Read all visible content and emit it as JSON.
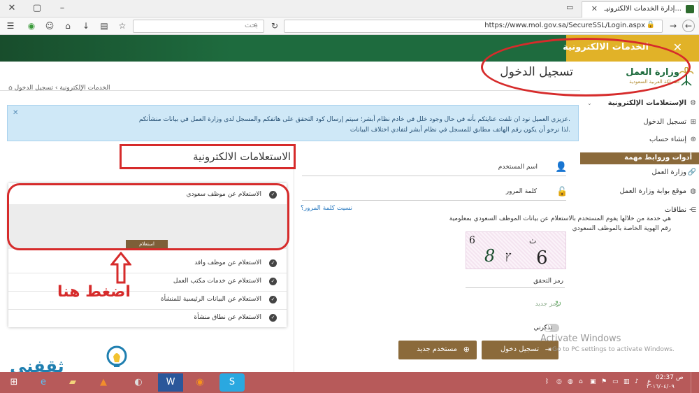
{
  "browser": {
    "tab_title": "إدارة الخدمات الالكترونيـ...",
    "url": "https://www.mol.gov.sa/SecureSSL/Login.aspx",
    "search_placeholder": "بحث"
  },
  "header": {
    "section_title": "الخدمات الالكترونية",
    "page_title": "تسجيل الدخول",
    "logo_name": "وزارة العمل",
    "logo_sub": "المملكة العربية السعودية",
    "breadcrumb": "الخدمات الإلكترونية  ›  تسجيل الدخول"
  },
  "banner": {
    "line1": "عزيزي العميل نود ان نلفت عنايتكم بأنه في حال وجود خلل في خادم نظام أبشر؛ سيتم إرسال كود التحقق على هاتفكم والمسجل لدى وزارة العمل في بيانات منشأتكم.",
    "line2": "لذا نرجو أن يكون رقم الهاتف مطابق للمسجل في نظام أبشر لتفادي اختلاف البيانات."
  },
  "sidebar": {
    "items": [
      {
        "label": "الإستعلامات الإلكترونية",
        "icon": "gear-icon"
      },
      {
        "label": "تسجيل الدخول",
        "icon": "login-icon"
      },
      {
        "label": "إنشاء حساب",
        "icon": "plus-circle-icon"
      }
    ],
    "tools_header": "أدوات وروابط مهمة",
    "links": [
      {
        "label": "وزارة العمل",
        "icon": "link-icon"
      },
      {
        "label": "موقع بوابة وزارة العمل",
        "icon": "globe-icon"
      },
      {
        "label": "نطاقات",
        "icon": "share-icon"
      }
    ]
  },
  "login": {
    "username_label": "اسم المستخدم",
    "password_label": "كلمة المرور",
    "forgot": "نسيت كلمة المرور؟",
    "captcha_chars": [
      "6",
      "8",
      "ץ",
      "6",
      "ٺ"
    ],
    "captcha_label": "رمز التحقق",
    "new_code": "رمز جديد",
    "remember": "تذكرني",
    "login_button": "تسجيل دخول",
    "new_user_button": "مستخدم جديد"
  },
  "inquiries": {
    "title": "الاستعلامات الالكترونية",
    "items": [
      "الاستعلام عن موظف سعودي",
      "الاستعلام عن موظف وافد",
      "الاستعلام عن خدمات مكتب العمل",
      "الاستعلام عن البيانات الرئيسية للمنشأة",
      "الاستعلام عن نطاق منشأة"
    ],
    "expanded_desc": "هي خدمة من خلالها يقوم المستخدم بالاستعلام عن بيانات الموظف السعودي بمعلومية رقم الهوية الخاصة بالموظف السعودي",
    "use_button": "استعلام"
  },
  "annotation": {
    "press_here": "اضغط هنا"
  },
  "watermark": {
    "line1": "Activate Windows",
    "line2": "Go to PC settings to activate Windows.",
    "brand": "ثقفني"
  },
  "taskbar": {
    "time": "02:37 ص",
    "date": "٢٠١٦/٠٤/٠٩",
    "lang": "ع"
  }
}
